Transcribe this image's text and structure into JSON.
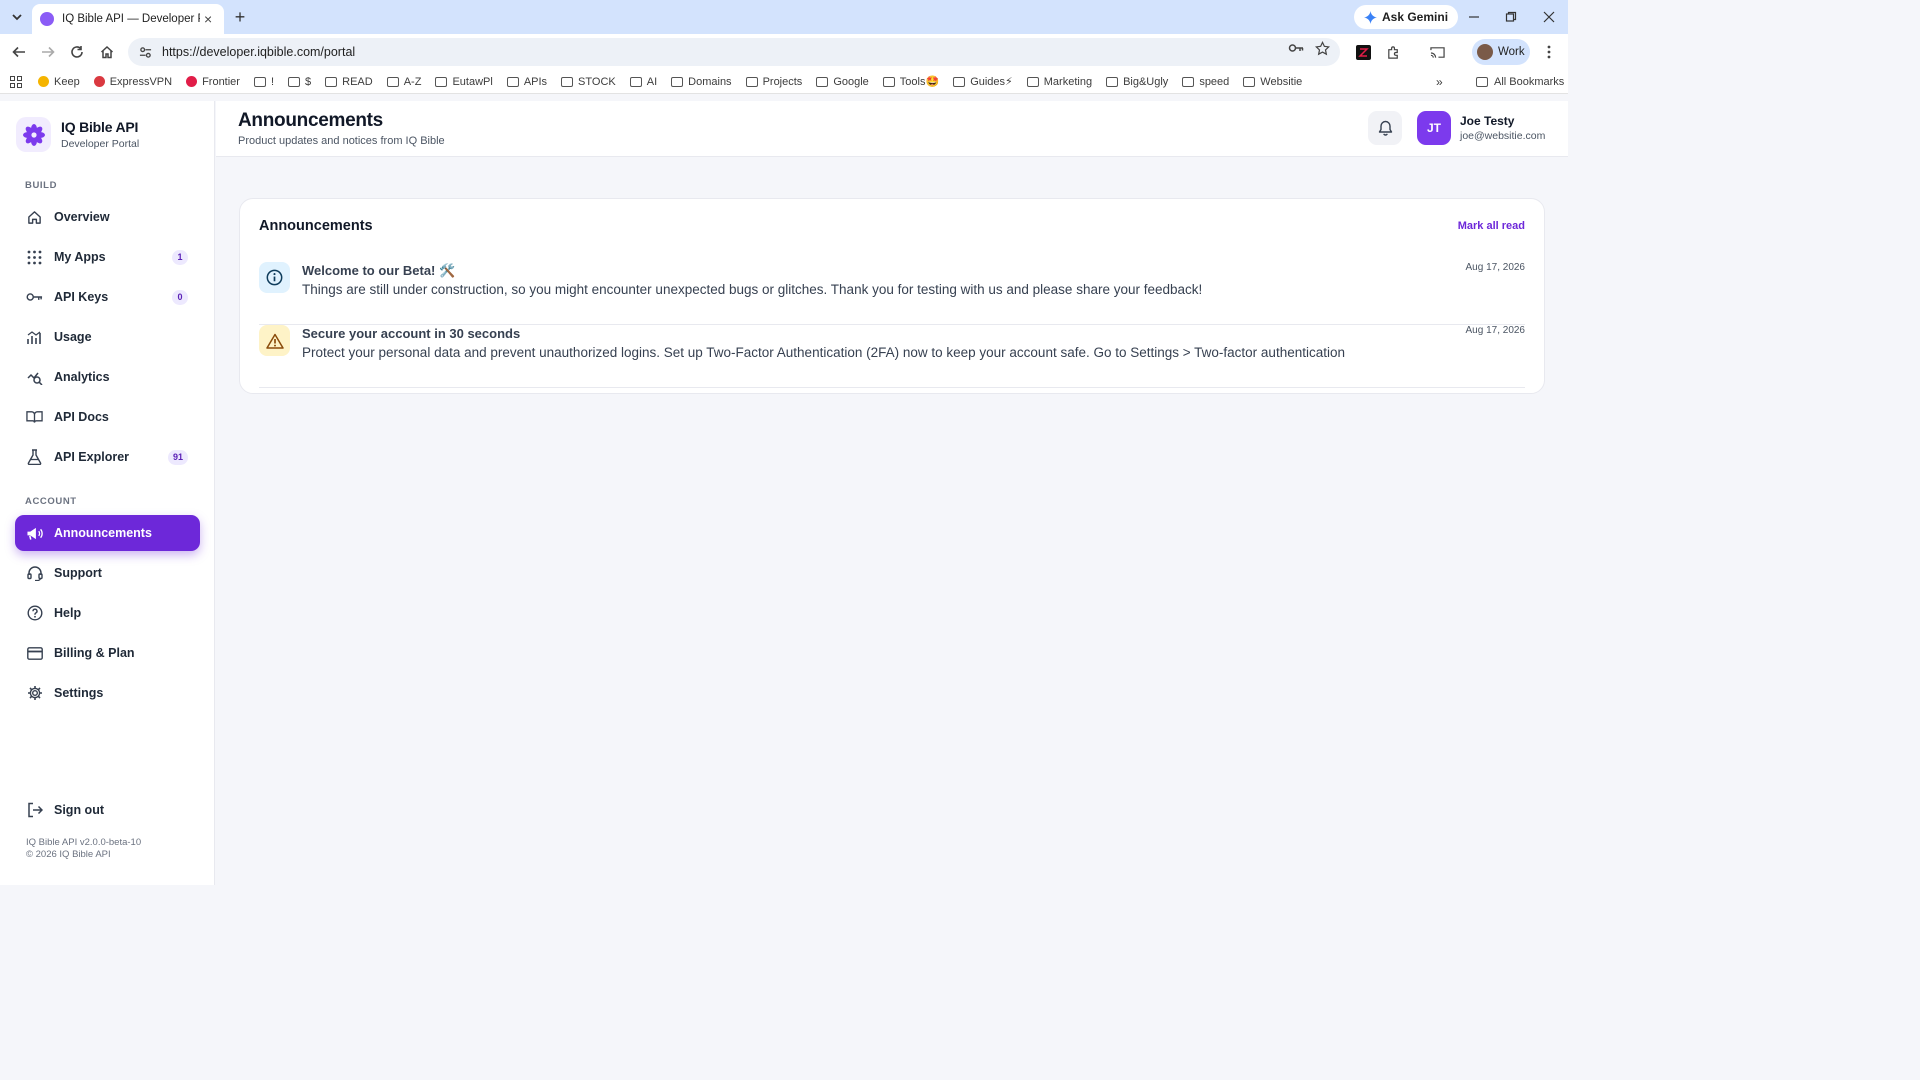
{
  "browser": {
    "tab_title": "IQ Bible API — Developer Portal",
    "tab_close": "×",
    "new_tab": "+",
    "ask_gemini": "Ask Gemini",
    "url": "https://developer.iqbible.com/portal",
    "profile_label": "Work",
    "bookmarks": [
      {
        "label": "Keep",
        "icon": "keep-icon"
      },
      {
        "label": "ExpressVPN",
        "icon": "expressvpn-icon"
      },
      {
        "label": "Frontier",
        "icon": "frontier-icon"
      },
      {
        "label": "!",
        "icon": "folder-icon"
      },
      {
        "label": "$",
        "icon": "folder-icon"
      },
      {
        "label": "READ",
        "icon": "folder-icon"
      },
      {
        "label": "A-Z",
        "icon": "folder-icon"
      },
      {
        "label": "EutawPl",
        "icon": "folder-icon"
      },
      {
        "label": "APIs",
        "icon": "folder-icon"
      },
      {
        "label": "STOCK",
        "icon": "folder-icon"
      },
      {
        "label": "AI",
        "icon": "folder-icon"
      },
      {
        "label": "Domains",
        "icon": "folder-icon"
      },
      {
        "label": "Projects",
        "icon": "folder-icon"
      },
      {
        "label": "Google",
        "icon": "folder-icon"
      },
      {
        "label": "Tools🤩",
        "icon": "folder-icon"
      },
      {
        "label": "Guides⚡",
        "icon": "folder-icon"
      },
      {
        "label": "Marketing",
        "icon": "folder-icon"
      },
      {
        "label": "Big&Ugly",
        "icon": "folder-icon"
      },
      {
        "label": "speed",
        "icon": "folder-icon"
      },
      {
        "label": "Websitie",
        "icon": "folder-icon"
      }
    ],
    "more_bookmarks": "»",
    "all_bookmarks": "All Bookmarks"
  },
  "sidebar": {
    "brand_title": "IQ Bible API",
    "brand_sub": "Developer Portal",
    "build_label": "BUILD",
    "account_label": "ACCOUNT",
    "build_items": [
      {
        "label": "Overview",
        "icon": "home-icon",
        "badge": ""
      },
      {
        "label": "My Apps",
        "icon": "grid-icon",
        "badge": "1"
      },
      {
        "label": "API Keys",
        "icon": "key-icon",
        "badge": "0"
      },
      {
        "label": "Usage",
        "icon": "bar-chart-icon",
        "badge": ""
      },
      {
        "label": "Analytics",
        "icon": "analytics-icon",
        "badge": ""
      },
      {
        "label": "API Docs",
        "icon": "book-icon",
        "badge": ""
      },
      {
        "label": "API Explorer",
        "icon": "flask-icon",
        "badge": "91"
      }
    ],
    "account_items": [
      {
        "label": "Announcements",
        "icon": "megaphone-icon",
        "active": true
      },
      {
        "label": "Support",
        "icon": "headset-icon"
      },
      {
        "label": "Help",
        "icon": "help-icon"
      },
      {
        "label": "Billing & Plan",
        "icon": "credit-card-icon"
      },
      {
        "label": "Settings",
        "icon": "gear-icon"
      }
    ],
    "sign_out": "Sign out",
    "version": "IQ Bible API v2.0.0-beta-10",
    "copyright": "© 2026 IQ Bible API"
  },
  "header": {
    "title": "Announcements",
    "subtitle": "Product updates and notices from IQ Bible",
    "user_initials": "JT",
    "user_name": "Joe Testy",
    "user_email": "joe@websitie.com"
  },
  "main": {
    "card_title": "Announcements",
    "mark_all_read": "Mark all read",
    "announcements": [
      {
        "title": "Welcome to our Beta! 🛠️",
        "body": "Things are still under construction, so you might encounter unexpected bugs or glitches. Thank you for testing with us and please share your feedback!",
        "date": "Aug 17, 2026",
        "icon": "info-icon"
      },
      {
        "title": "Secure your account in 30 seconds",
        "body": "Protect your personal data and prevent unauthorized logins. Set up Two-Factor Authentication (2FA) now to keep your account safe. Go to Settings > Two-factor authentication",
        "date": "Aug 17, 2026",
        "icon": "warning-icon"
      }
    ]
  },
  "colors": {
    "accent": "#6d28d9",
    "badge_bg": "#ede9fe",
    "info_bg": "#e0f2fe",
    "warning_bg": "#fef3c7"
  }
}
